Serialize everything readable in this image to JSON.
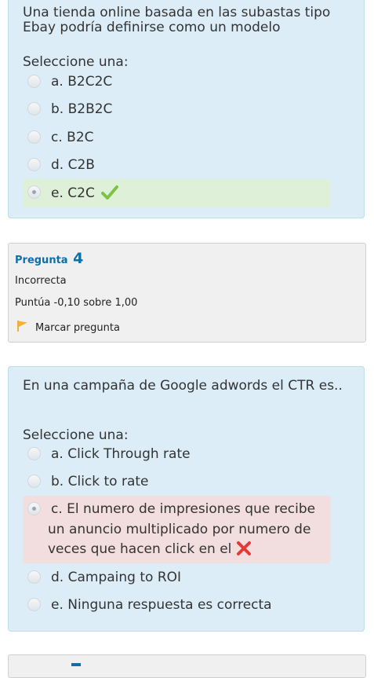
{
  "question3": {
    "text": "Una tienda  online basada en las subastas tipo Ebay podría definirse como un modelo",
    "prompt": "Seleccione una:",
    "options": [
      {
        "label": "a. B2C2C",
        "state": "none"
      },
      {
        "label": "b. B2B2C",
        "state": "none"
      },
      {
        "label": "c. B2C",
        "state": "none"
      },
      {
        "label": "d. C2B",
        "state": "none"
      },
      {
        "label": "e. C2C",
        "state": "correct"
      }
    ]
  },
  "question4_info": {
    "pregunta_label": "Pregunta",
    "number": "4",
    "status": "Incorrecta",
    "score": "Puntúa -0,10 sobre 1,00",
    "flag_label": "Marcar pregunta",
    "flag_icon": "flag-icon"
  },
  "question4": {
    "text": "En una campaña de Google adwords el CTR es..",
    "prompt": "Seleccione una:",
    "options": [
      {
        "label": "a. Click Through rate",
        "state": "none"
      },
      {
        "label": "b. Click to rate",
        "state": "none"
      },
      {
        "label": "c. El numero de impresiones que recibe un anuncio multiplicado por numero de veces que hacen click en el",
        "state": "incorrect"
      },
      {
        "label": "d. Campaing to ROI",
        "state": "none"
      },
      {
        "label": "e. Ninguna respuesta es correcta",
        "state": "none"
      }
    ]
  },
  "colors": {
    "question_bg": "#dcedf7",
    "correct_bg": "#dff0d8",
    "incorrect_bg": "#f2dede",
    "info_bg": "#f0f0f0",
    "accent": "#0f6fa6",
    "check": "#7cc243",
    "cross": "#e53935"
  }
}
